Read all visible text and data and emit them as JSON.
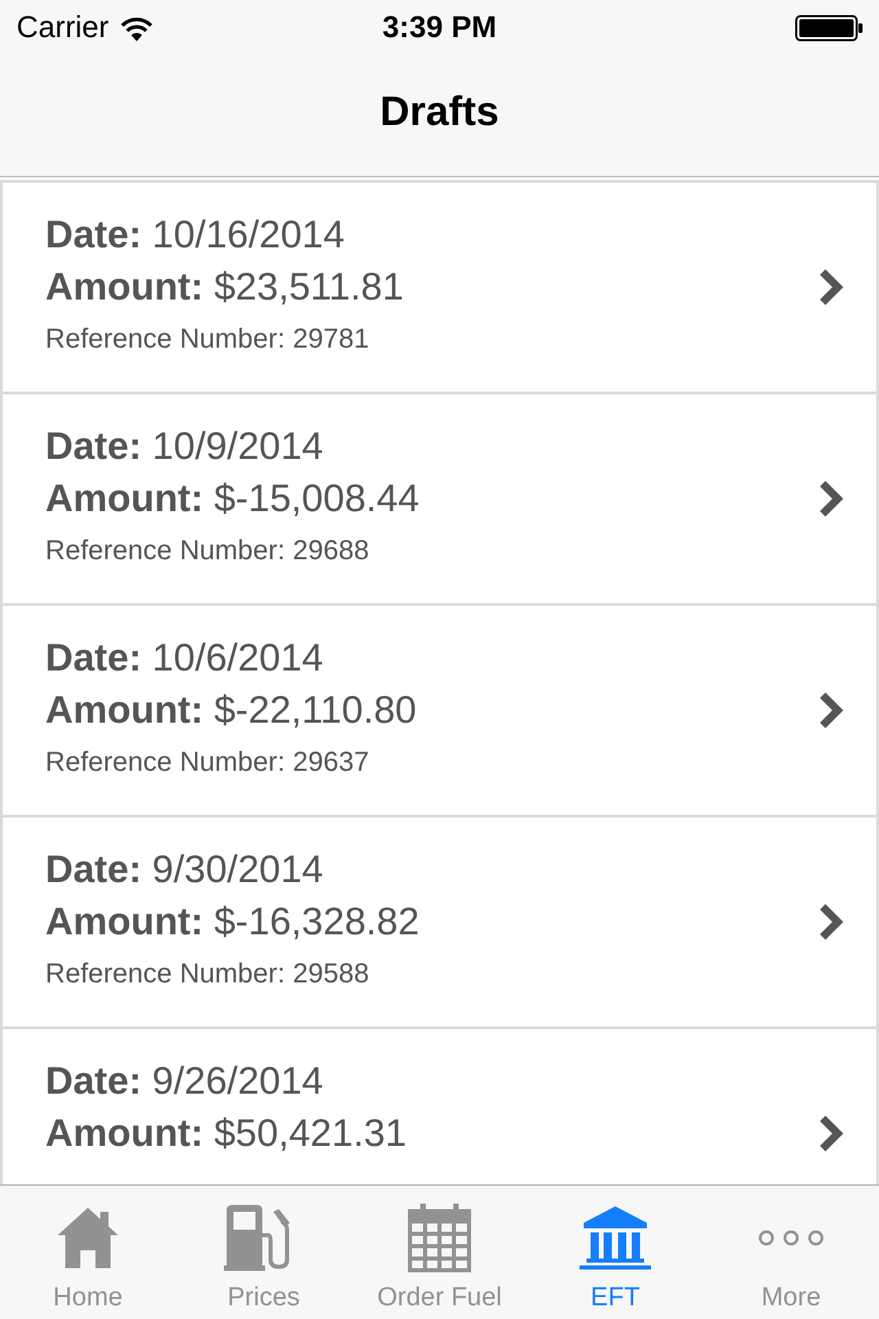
{
  "status_bar": {
    "carrier": "Carrier",
    "time": "3:39 PM"
  },
  "nav_bar": {
    "title": "Drafts"
  },
  "drafts": [
    {
      "date": "**Date:** 10/16/2014",
      "amount": "**Amount:** $23,511.81",
      "reference": "Reference Number: 29781"
    },
    {
      "date": "**Date:** 10/9/2014",
      "amount": "**Amount:** $-15,008.44",
      "reference": "Reference Number: 29688"
    },
    {
      "date": "**Date:** 10/6/2014",
      "amount": "**Amount:** $-22,110.80",
      "reference": "Reference Number: 29637"
    },
    {
      "date": "**Date:** 9/30/2014",
      "amount": "**Amount:** $-16,328.82",
      "reference": "Reference Number: 29588"
    },
    {
      "date": "**Date:** 9/26/2014",
      "amount": "**Amount:** $50,421.31"
    }
  ],
  "tab_bar": {
    "tabs": [
      {
        "label": "Home",
        "selected": false
      },
      {
        "label": "Prices",
        "selected": false
      },
      {
        "label": "Order Fuel",
        "selected": false
      },
      {
        "label": "EFT",
        "selected": true
      },
      {
        "label": "More",
        "selected": false
      }
    ]
  }
}
